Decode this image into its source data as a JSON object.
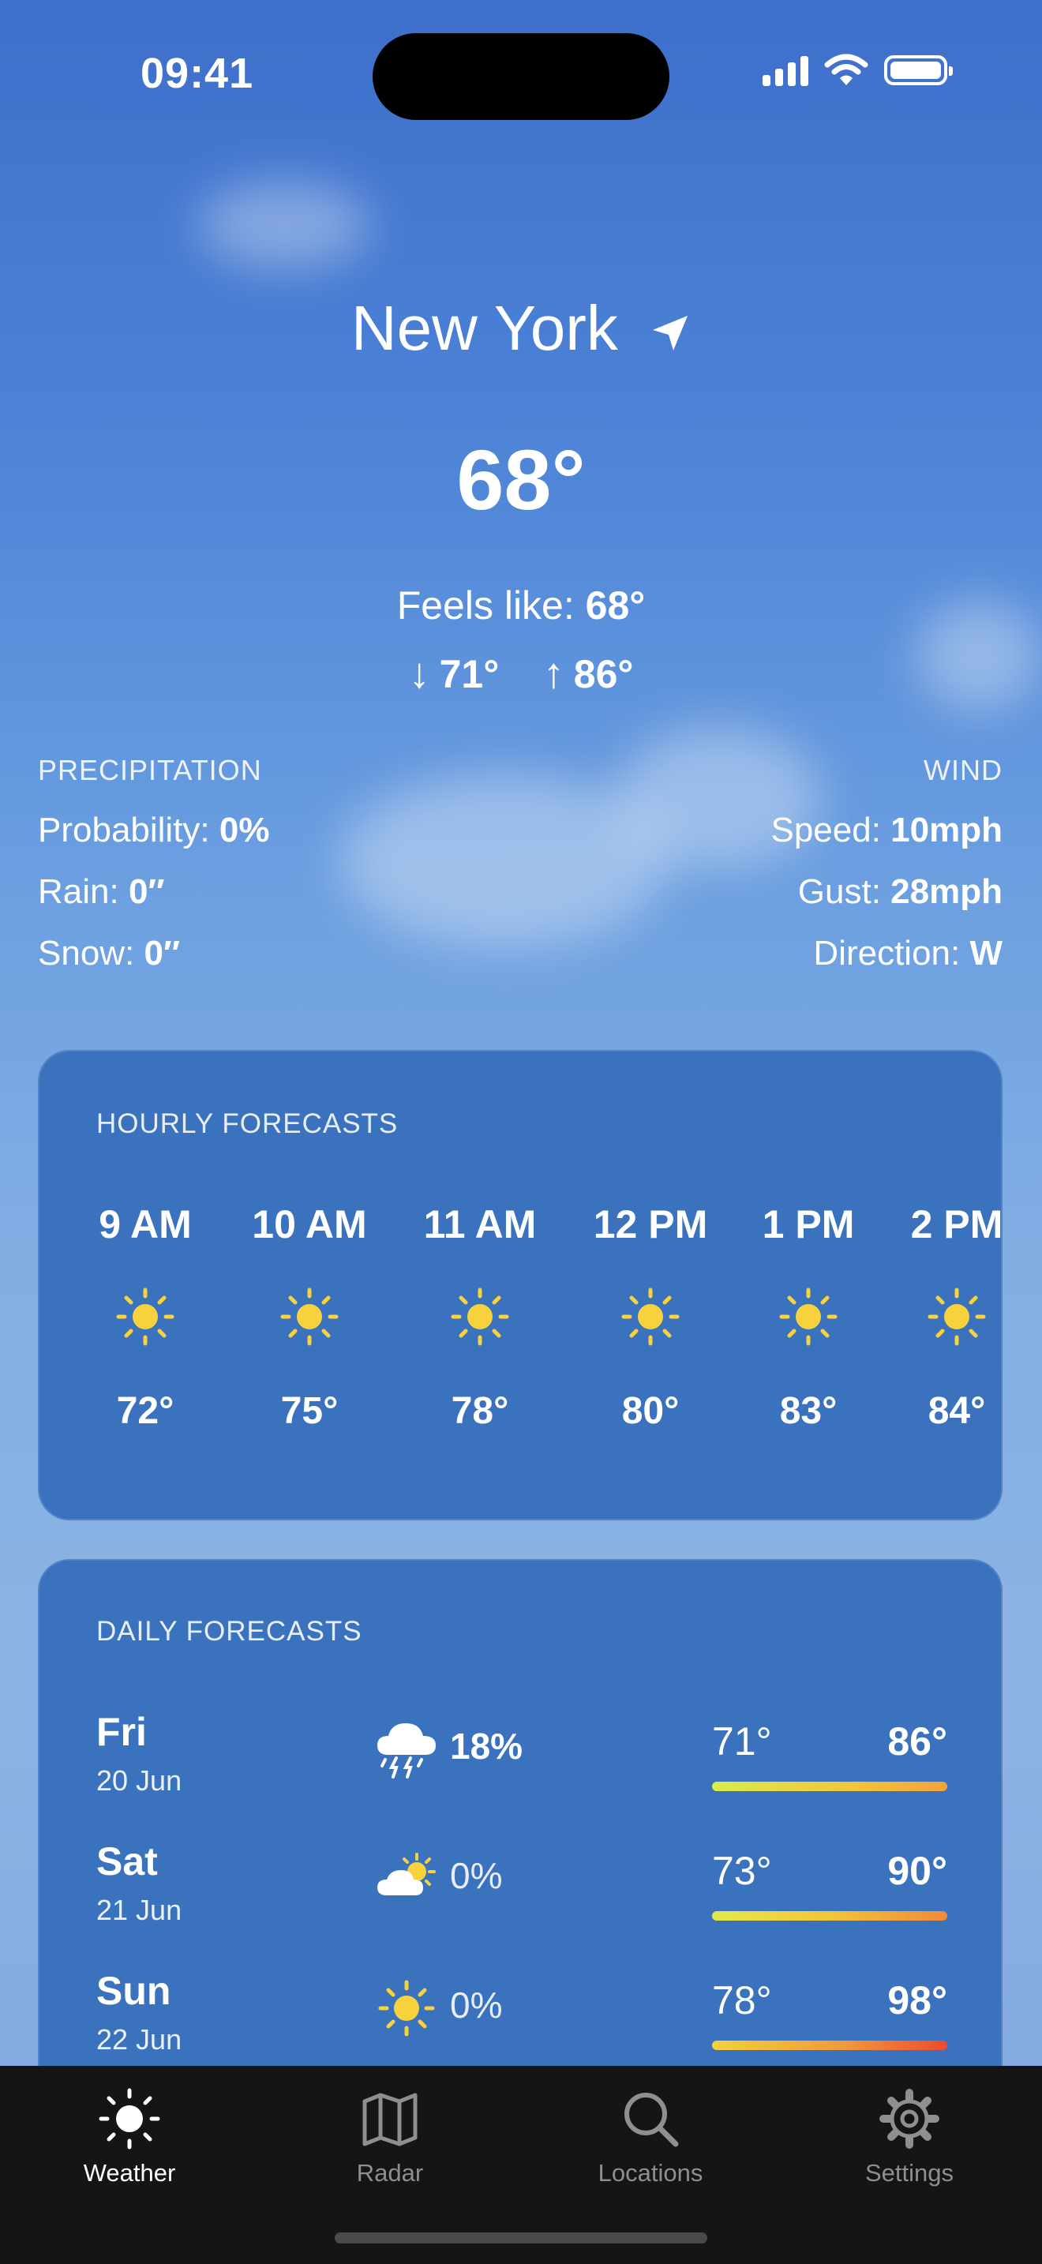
{
  "status_bar": {
    "time": "09:41"
  },
  "current": {
    "city": "New York",
    "temperature": "68°",
    "feels_like_label": "Feels like:",
    "feels_like_value": "68°",
    "low": "71°",
    "high": "86°"
  },
  "precipitation": {
    "title": "PRECIPITATION",
    "probability_label": "Probability:",
    "probability_value": "0%",
    "rain_label": "Rain:",
    "rain_value": "0″",
    "snow_label": "Snow:",
    "snow_value": "0″"
  },
  "wind": {
    "title": "WIND",
    "speed_label": "Speed:",
    "speed_value": "10mph",
    "gust_label": "Gust:",
    "gust_value": "28mph",
    "direction_label": "Direction:",
    "direction_value": "W"
  },
  "hourly": {
    "title": "HOURLY FORECASTS",
    "items": [
      {
        "hour": "9 AM",
        "icon": "sun-icon",
        "temp": "72°"
      },
      {
        "hour": "10 AM",
        "icon": "sun-icon",
        "temp": "75°"
      },
      {
        "hour": "11 AM",
        "icon": "sun-icon",
        "temp": "78°"
      },
      {
        "hour": "12 PM",
        "icon": "sun-icon",
        "temp": "80°"
      },
      {
        "hour": "1 PM",
        "icon": "sun-icon",
        "temp": "83°"
      },
      {
        "hour": "2 PM",
        "icon": "sun-icon",
        "temp": "84°"
      }
    ]
  },
  "daily": {
    "title": "DAILY FORECASTS",
    "items": [
      {
        "day": "Fri",
        "date": "20 Jun",
        "icon": "thunderstorm-icon",
        "precip": "18%",
        "low": "71°",
        "high": "86°"
      },
      {
        "day": "Sat",
        "date": "21 Jun",
        "icon": "partly-cloudy-icon",
        "precip": "0%",
        "low": "73°",
        "high": "90°"
      },
      {
        "day": "Sun",
        "date": "22 Jun",
        "icon": "sun-icon",
        "precip": "0%",
        "low": "78°",
        "high": "98°"
      }
    ]
  },
  "tabs": [
    {
      "label": "Weather",
      "icon": "sun-icon",
      "active": true
    },
    {
      "label": "Radar",
      "icon": "map-icon",
      "active": false
    },
    {
      "label": "Locations",
      "icon": "search-icon",
      "active": false
    },
    {
      "label": "Settings",
      "icon": "gear-icon",
      "active": false
    }
  ],
  "colors": {
    "sun": "#f7d23c",
    "card": "#3b72bd",
    "tabbar": "#151515"
  }
}
